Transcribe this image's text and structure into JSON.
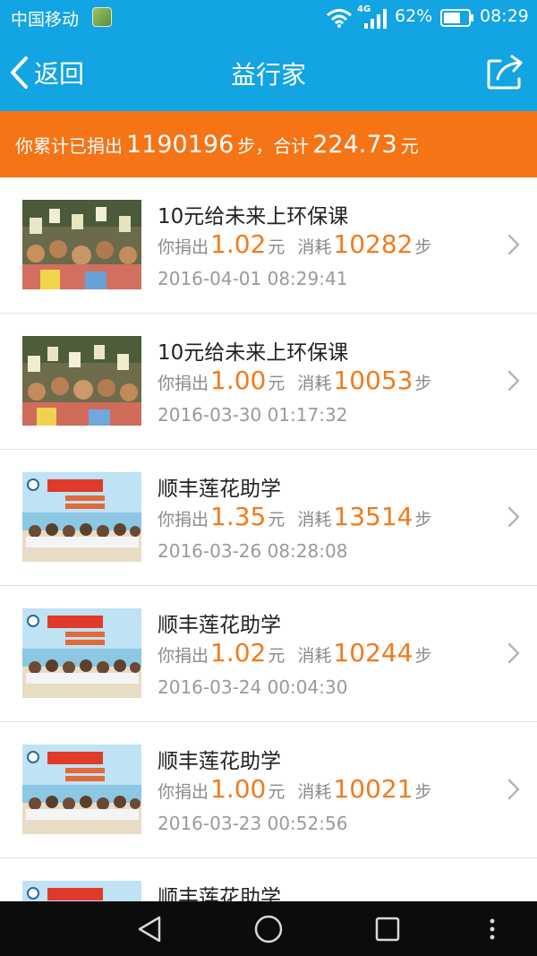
{
  "status_bar": {
    "carrier": "中国移动",
    "network": "4G",
    "battery_percent": "62%",
    "time": "08:29"
  },
  "nav": {
    "back_label": "返回",
    "title": "益行家"
  },
  "summary": {
    "prefix": "你累计已捐出",
    "steps": "1190196",
    "middle": "步，合计",
    "amount": "224.73",
    "suffix": "元"
  },
  "labels": {
    "donated": "你捐出",
    "yuan": "元",
    "consumed": "消耗",
    "steps_unit": "步"
  },
  "colors": {
    "header_blue": "#12a4e3",
    "banner_orange": "#f57416",
    "amount_orange": "#f27a1c"
  },
  "donations": [
    {
      "title": "10元给未来上环保课",
      "amount": "1.02",
      "steps": "10282",
      "time": "2016-04-01 08:29:41",
      "thumb": "classroom-photo"
    },
    {
      "title": "10元给未来上环保课",
      "amount": "1.00",
      "steps": "10053",
      "time": "2016-03-30 01:17:32",
      "thumb": "classroom-photo"
    },
    {
      "title": "顺丰莲花助学",
      "amount": "1.35",
      "steps": "13514",
      "time": "2016-03-26 08:28:08",
      "thumb": "beach-students-photo"
    },
    {
      "title": "顺丰莲花助学",
      "amount": "1.02",
      "steps": "10244",
      "time": "2016-03-24 00:04:30",
      "thumb": "beach-students-photo"
    },
    {
      "title": "顺丰莲花助学",
      "amount": "1.00",
      "steps": "10021",
      "time": "2016-03-23 00:52:56",
      "thumb": "beach-students-photo"
    },
    {
      "title": "顺丰莲花助学",
      "thumb": "beach-students-photo"
    }
  ]
}
